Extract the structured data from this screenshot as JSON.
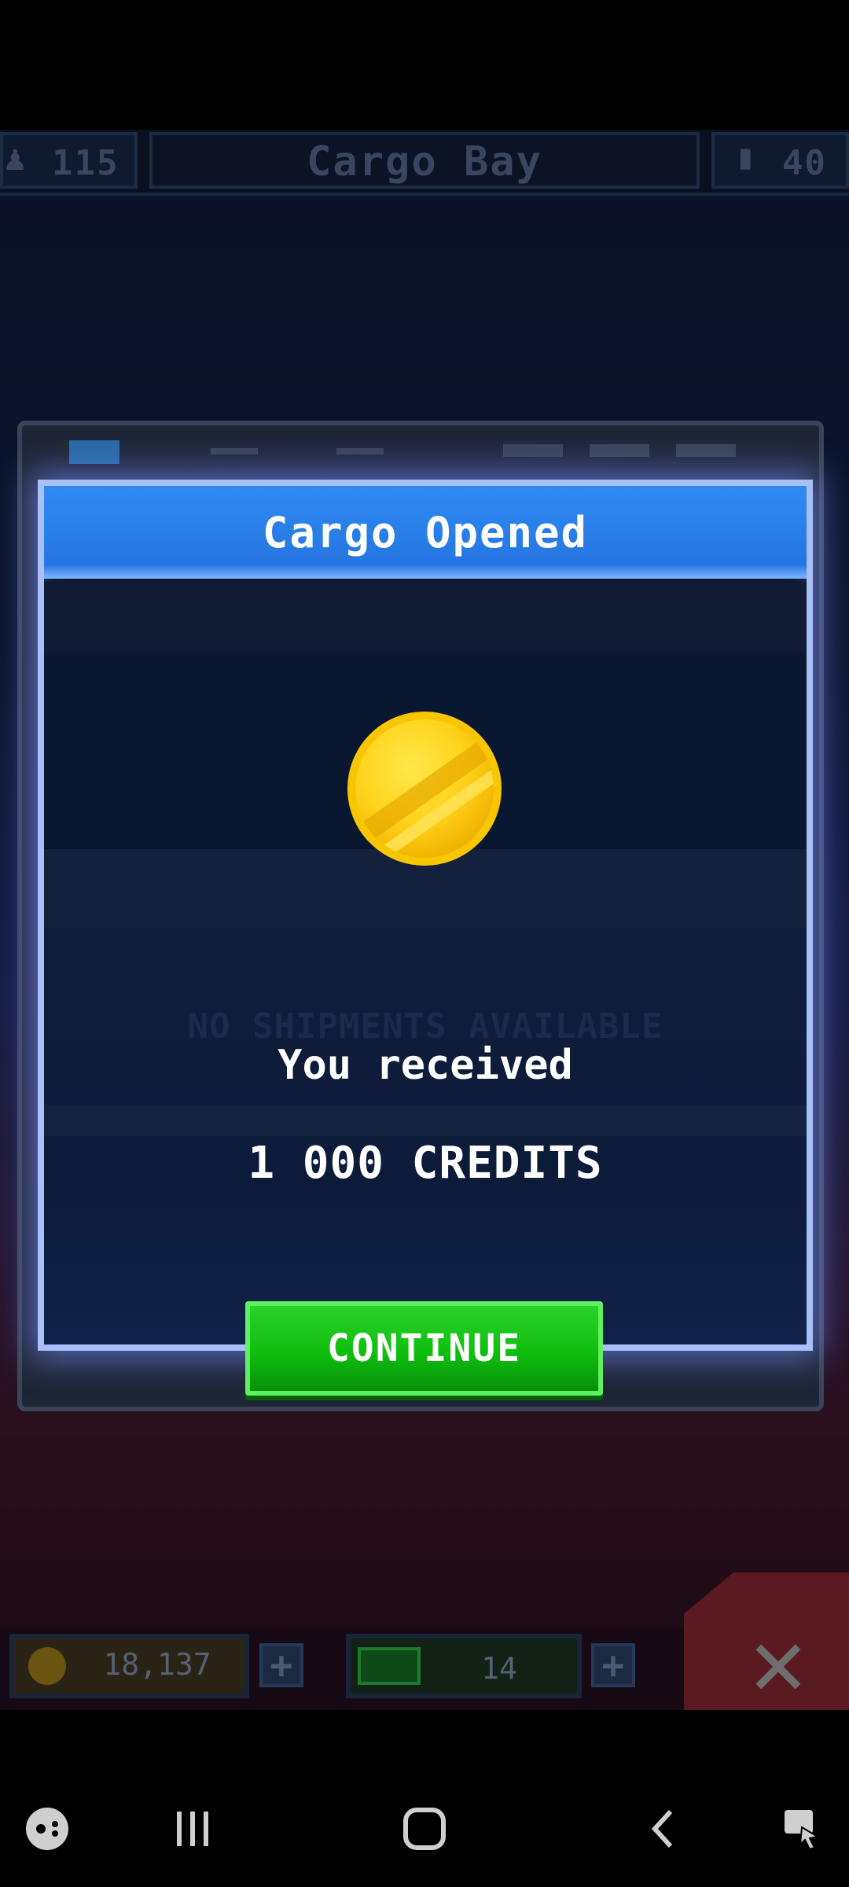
{
  "header": {
    "crew_count": "115",
    "title": "Cargo Bay",
    "fuel_count": "40",
    "crew_icon": "person-icon",
    "fuel_icon": "fuel-icon"
  },
  "modal": {
    "title": "Cargo Opened",
    "background_text": "NO SHIPMENTS AVAILABLE",
    "received_label": "You received",
    "reward_text": "1 000 CREDITS",
    "reward_icon": "gold-coin-icon",
    "continue_label": "CONTINUE"
  },
  "bottom": {
    "credits": "18,137",
    "gems": "14",
    "plus_label": "+",
    "close_label": "✕"
  },
  "nav": {
    "game_icon": "game-launcher-icon",
    "recents_icon": "recent-apps-icon",
    "home_icon": "home-icon",
    "back_icon": "back-icon",
    "assist_icon": "screen-assist-icon"
  },
  "colors": {
    "modal_header": "#2f8bf2",
    "modal_border": "#a9bff8",
    "continue_button": "#11c511",
    "coin": "#ffd21a"
  }
}
